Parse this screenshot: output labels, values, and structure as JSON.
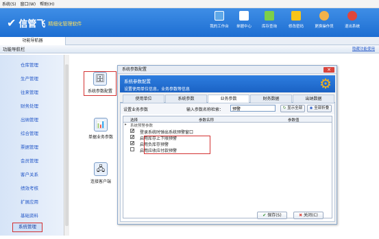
{
  "menubar": {
    "items": [
      "系统(S)",
      "窗口(W)",
      "帮助(H)"
    ]
  },
  "header": {
    "logo": "信管飞",
    "slogan": "精细化管理软件",
    "tools": [
      {
        "label": "我的工作台",
        "icon": "monitor-icon",
        "color": "#5fa8e8"
      },
      {
        "label": "单据中心",
        "icon": "document-icon",
        "color": "#ffffff"
      },
      {
        "label": "库存查询",
        "icon": "inventory-icon",
        "color": "#7ccf4a"
      },
      {
        "label": "修改密码",
        "icon": "lock-icon",
        "color": "#f6c419"
      },
      {
        "label": "更换操作员",
        "icon": "user-icon",
        "color": "#f2b24a"
      },
      {
        "label": "退出系统",
        "icon": "exit-icon",
        "color": "#e0463b"
      }
    ]
  },
  "tabs": {
    "active": "功能导航器"
  },
  "nav": {
    "title": "功能导航栏",
    "right_link": "隐藏功能使用"
  },
  "sidebar": {
    "items": [
      "仓库管理",
      "生产管理",
      "往来管理",
      "财务处理",
      "出纳管理",
      "综合管理",
      "票据管理",
      "会员管理",
      "客户关系",
      "绩效考核",
      "扩展应用",
      "基础资料",
      "系统管理"
    ],
    "active": "系统管理"
  },
  "modules": [
    {
      "label": "系统参数配置",
      "icon": "database-icon"
    },
    {
      "label": "单据业务参数",
      "icon": "chart-icon"
    },
    {
      "label": "连接客户端",
      "icon": "network-icon"
    }
  ],
  "dialog": {
    "title": "系统参数配置",
    "close": "✕",
    "banner_title": "系统参数配置",
    "banner_sub": "设置使用单位信息，业务参数等信息",
    "tabs": [
      "使用单位",
      "系统参数",
      "业务参数",
      "财务数据",
      "出纳数据"
    ],
    "active_tab": "业务参数",
    "set_label": "设置业务参数",
    "search_label": "输入参数名称检索：",
    "search_value": "预警",
    "show_all": "显示全部",
    "collapse_all": "全部折叠",
    "grid_headers": {
      "select": "选择",
      "name": "参数名称",
      "value": "参数值"
    },
    "group": "系统预警参数",
    "rows": [
      {
        "label": "登录系统时弹出系统预警窗口",
        "checked": "✔"
      },
      {
        "label": "启用库存上下限预警",
        "checked": "✔"
      },
      {
        "label": "启用负库存预警",
        "checked": "✔"
      },
      {
        "label": "启用应收应付款预警",
        "checked": ""
      }
    ],
    "save": "保存(S)",
    "close_btn": "关闭(C)"
  }
}
